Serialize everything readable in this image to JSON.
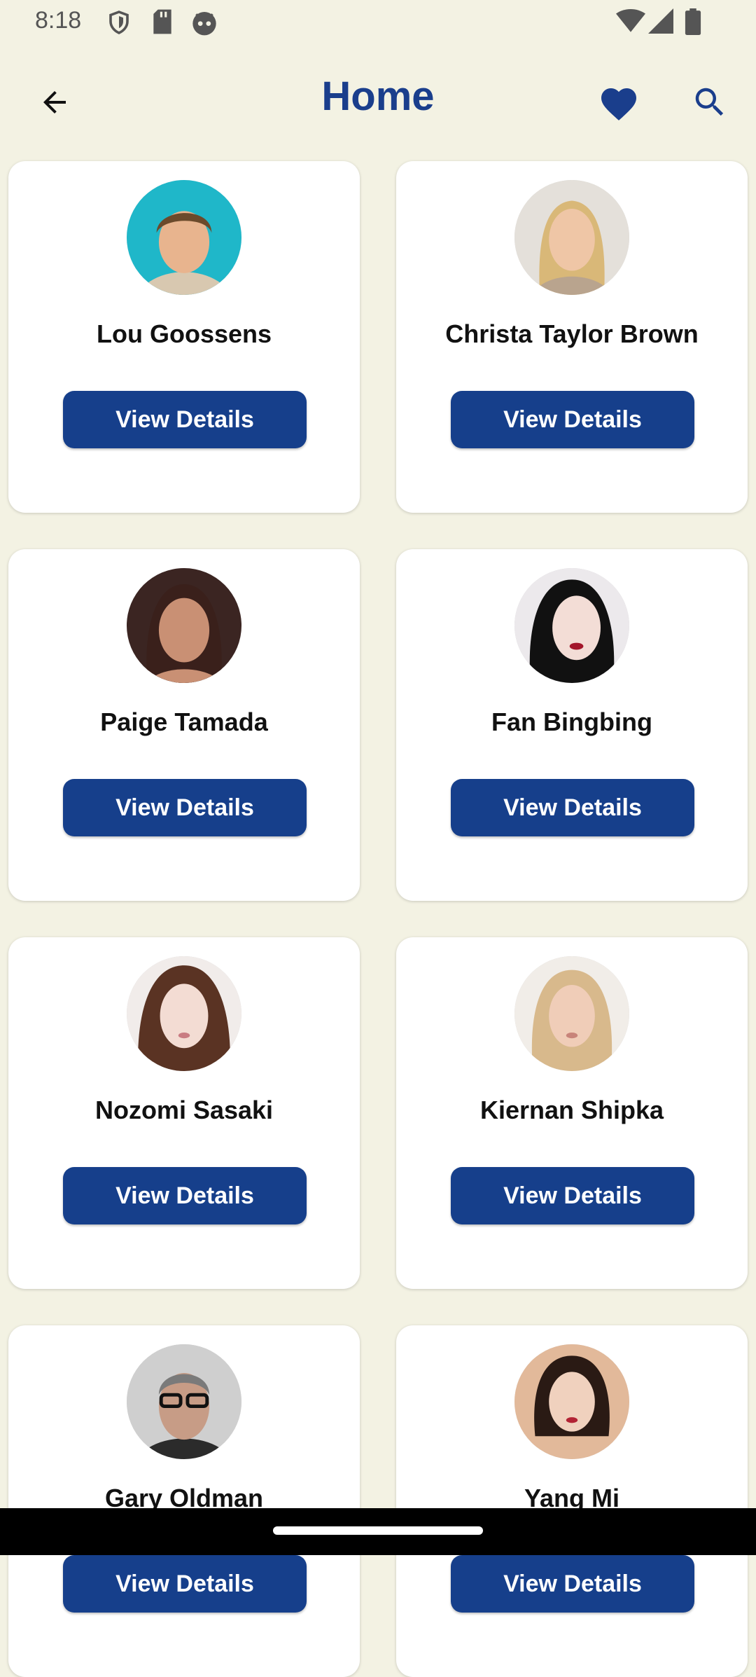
{
  "status_bar": {
    "time": "8:18",
    "left_icons": [
      "shield-icon",
      "sd-card-icon",
      "android-head-icon"
    ],
    "right_icons": [
      "wifi-icon",
      "signal-icon",
      "battery-icon"
    ]
  },
  "app_bar": {
    "title": "Home",
    "back_icon": "arrow-back-icon",
    "favorite_icon": "heart-icon",
    "search_icon": "search-icon",
    "accent_color": "#1A3E8C"
  },
  "cards": [
    {
      "name": "Lou Goossens",
      "button": "View Details",
      "avatar_bg": "#1FB7C9",
      "skin": "#E8B48E",
      "hair": "#6B4A2B"
    },
    {
      "name": "Christa Taylor Brown",
      "button": "View Details",
      "avatar_bg": "#E4E0DA",
      "skin": "#EFC6A6",
      "hair": "#D9B878"
    },
    {
      "name": "Paige Tamada",
      "button": "View Details",
      "avatar_bg": "#3B2522",
      "skin": "#C99074",
      "hair": "#3A201B"
    },
    {
      "name": "Fan Bingbing",
      "button": "View Details",
      "avatar_bg": "#ECE9EC",
      "skin": "#F3DDD6",
      "hair": "#111111"
    },
    {
      "name": "Nozomi Sasaki",
      "button": "View Details",
      "avatar_bg": "#F1ECEA",
      "skin": "#F3DCD3",
      "hair": "#5A3323"
    },
    {
      "name": "Kiernan Shipka",
      "button": "View Details",
      "avatar_bg": "#F1EDE8",
      "skin": "#F0CDB8",
      "hair": "#D8B98C"
    },
    {
      "name": "Gary Oldman",
      "button": "View Details",
      "avatar_bg": "#CFCFCF",
      "skin": "#C79C86",
      "hair": "#7A7A7A"
    },
    {
      "name": "Yang Mi",
      "button": "View Details",
      "avatar_bg": "#E2B99A",
      "skin": "#F0D1BE",
      "hair": "#2A1A14"
    }
  ],
  "button_color": "#163F8B"
}
